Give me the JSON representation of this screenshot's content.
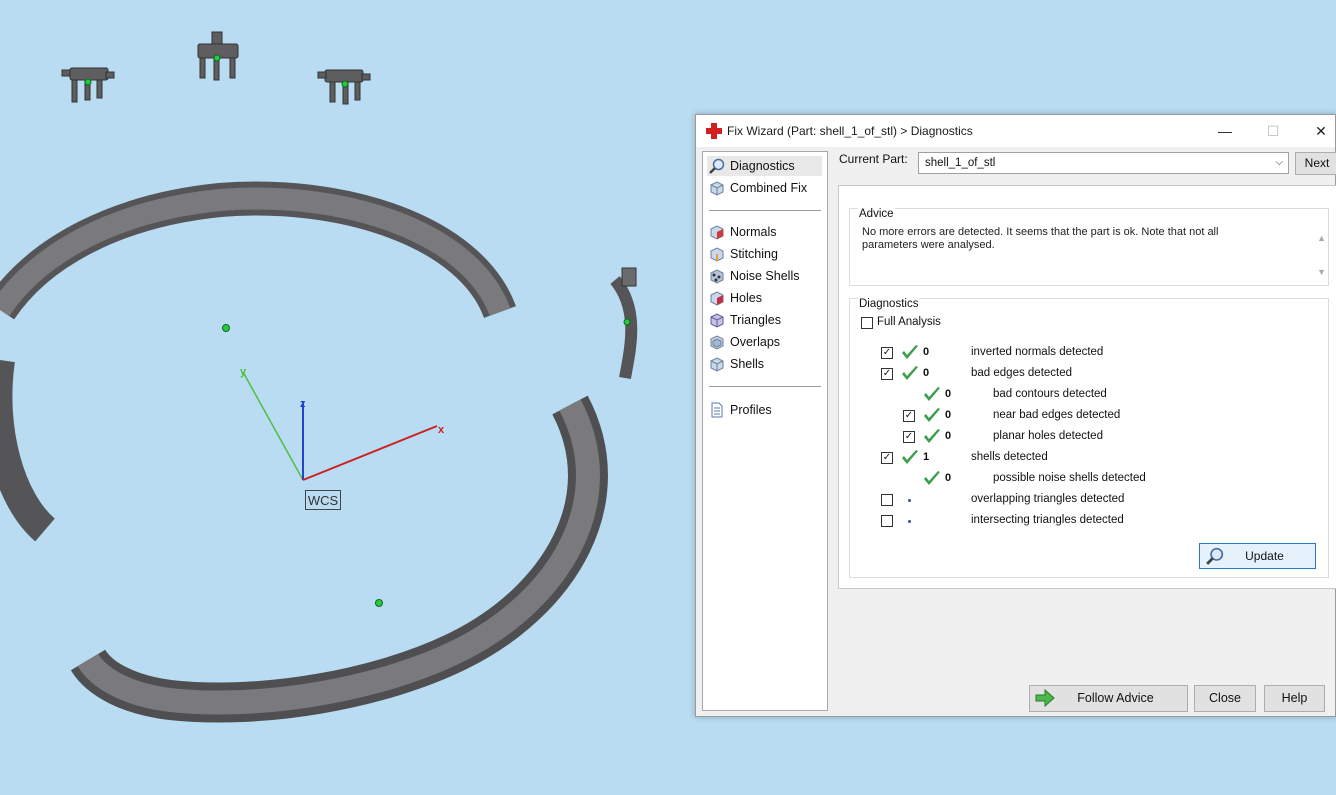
{
  "viewport": {
    "wcs_label": "WCS",
    "axis_x": "x",
    "axis_y": "y",
    "axis_z": "z"
  },
  "dialog": {
    "title": "Fix Wizard (Part: shell_1_of_stl) > Diagnostics",
    "title_icon": "red-cross-icon",
    "window_buttons": {
      "minimize": "—",
      "maximize": "☐",
      "close": "✕"
    },
    "nav": {
      "group1": [
        {
          "label": "Diagnostics",
          "icon": "magnifier-icon",
          "active": true
        },
        {
          "label": "Combined Fix",
          "icon": "cube-icon"
        }
      ],
      "group2": [
        {
          "label": "Normals",
          "icon": "normals-icon"
        },
        {
          "label": "Stitching",
          "icon": "stitching-icon"
        },
        {
          "label": "Noise Shells",
          "icon": "noise-shells-icon"
        },
        {
          "label": "Holes",
          "icon": "holes-icon"
        },
        {
          "label": "Triangles",
          "icon": "triangles-icon"
        },
        {
          "label": "Overlaps",
          "icon": "overlaps-icon"
        },
        {
          "label": "Shells",
          "icon": "shells-icon"
        }
      ],
      "group3": [
        {
          "label": "Profiles",
          "icon": "document-icon"
        }
      ]
    },
    "current_part": {
      "label": "Current Part:",
      "value": "shell_1_of_stl",
      "next_label": "Next"
    },
    "advice": {
      "title": "Advice",
      "text": "No more errors are detected. It seems that the part is ok. Note that not all parameters were analysed."
    },
    "diagnostics": {
      "title": "Diagnostics",
      "full_analysis_label": "Full Analysis",
      "full_analysis_checked": false,
      "rows": [
        {
          "checkbox": true,
          "checked": true,
          "status": "ok",
          "count": "0",
          "label": "inverted normals detected",
          "indent": 0
        },
        {
          "checkbox": true,
          "checked": true,
          "status": "ok",
          "count": "0",
          "label": "bad edges detected",
          "indent": 0
        },
        {
          "checkbox": false,
          "checked": false,
          "status": "ok",
          "count": "0",
          "label": "bad contours detected",
          "indent": 1
        },
        {
          "checkbox": true,
          "checked": true,
          "status": "ok",
          "count": "0",
          "label": "near bad edges detected",
          "indent": 1
        },
        {
          "checkbox": true,
          "checked": true,
          "status": "ok",
          "count": "0",
          "label": "planar holes detected",
          "indent": 1
        },
        {
          "checkbox": true,
          "checked": true,
          "status": "ok",
          "count": "1",
          "label": "shells detected",
          "indent": 0
        },
        {
          "checkbox": false,
          "checked": false,
          "status": "ok",
          "count": "0",
          "label": "possible noise shells detected",
          "indent": 1
        },
        {
          "checkbox": true,
          "checked": false,
          "status": "pending",
          "count": "",
          "label": "overlapping triangles detected",
          "indent": 0
        },
        {
          "checkbox": true,
          "checked": false,
          "status": "pending",
          "count": "",
          "label": "intersecting triangles detected",
          "indent": 0
        }
      ],
      "update_label": "Update"
    },
    "buttons": {
      "follow_advice": "Follow Advice",
      "close": "Close",
      "help": "Help"
    },
    "colors": {
      "tick_green": "#3a9e4a",
      "accent_blue": "#2a79c9",
      "viewport_bg": "#b9dcf3",
      "model_gray": "#6b6b6d"
    }
  }
}
